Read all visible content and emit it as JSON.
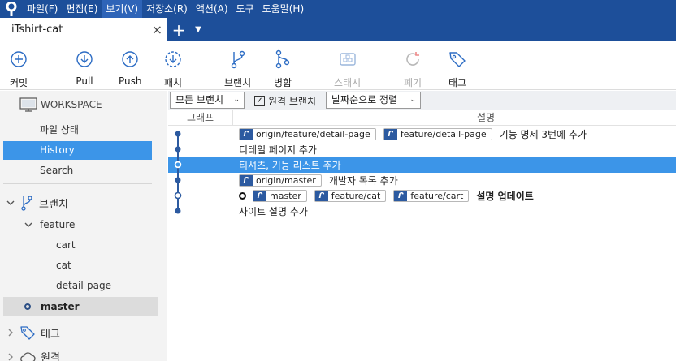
{
  "menubar": {
    "items": [
      {
        "label": "파일(F)"
      },
      {
        "label": "편집(E)"
      },
      {
        "label": "보기(V)"
      },
      {
        "label": "저장소(R)"
      },
      {
        "label": "액션(A)"
      },
      {
        "label": "도구"
      },
      {
        "label": "도움말(H)"
      }
    ]
  },
  "tabs": {
    "active": "iTshirt-cat",
    "close": "×",
    "add": "+",
    "menu": "▼"
  },
  "toolbar": {
    "commit": "커밋",
    "pull": "Pull",
    "push": "Push",
    "fetch": "패치",
    "branch": "브랜치",
    "merge": "병합",
    "stash": "스태시",
    "discard": "폐기",
    "tag": "태그"
  },
  "sidebar": {
    "workspace": "WORKSPACE",
    "ws_items": [
      "파일 상태",
      "History",
      "Search"
    ],
    "branches": "브랜치",
    "feature": "feature",
    "feature_children": [
      "cart",
      "cat",
      "detail-page"
    ],
    "master": "master",
    "tags": "태그",
    "remotes": "원격"
  },
  "filter": {
    "branches": "모든 브랜치",
    "remote_branches": "원격 브랜치",
    "sort": "날짜순으로 정렬"
  },
  "columns": {
    "graph": "그래프",
    "description": "설명"
  },
  "commits": [
    {
      "refs": [
        "origin/feature/detail-page",
        "feature/detail-page"
      ],
      "message": "기능 명세 3번에 추가"
    },
    {
      "refs": [],
      "message": "디테일 페이지 추가"
    },
    {
      "refs": [],
      "message": "티셔츠, 기능 리스트 추가"
    },
    {
      "refs": [
        "origin/master"
      ],
      "message": "개발자 목록 추가"
    },
    {
      "refs": [
        "master",
        "feature/cat",
        "feature/cart"
      ],
      "message": "설명 업데이트"
    },
    {
      "refs": [],
      "message": "사이트 설명 추가"
    }
  ],
  "colors": {
    "accent": "#1d4f9a",
    "selection": "#3c95e8",
    "graph_line": "#2c5aa0"
  }
}
